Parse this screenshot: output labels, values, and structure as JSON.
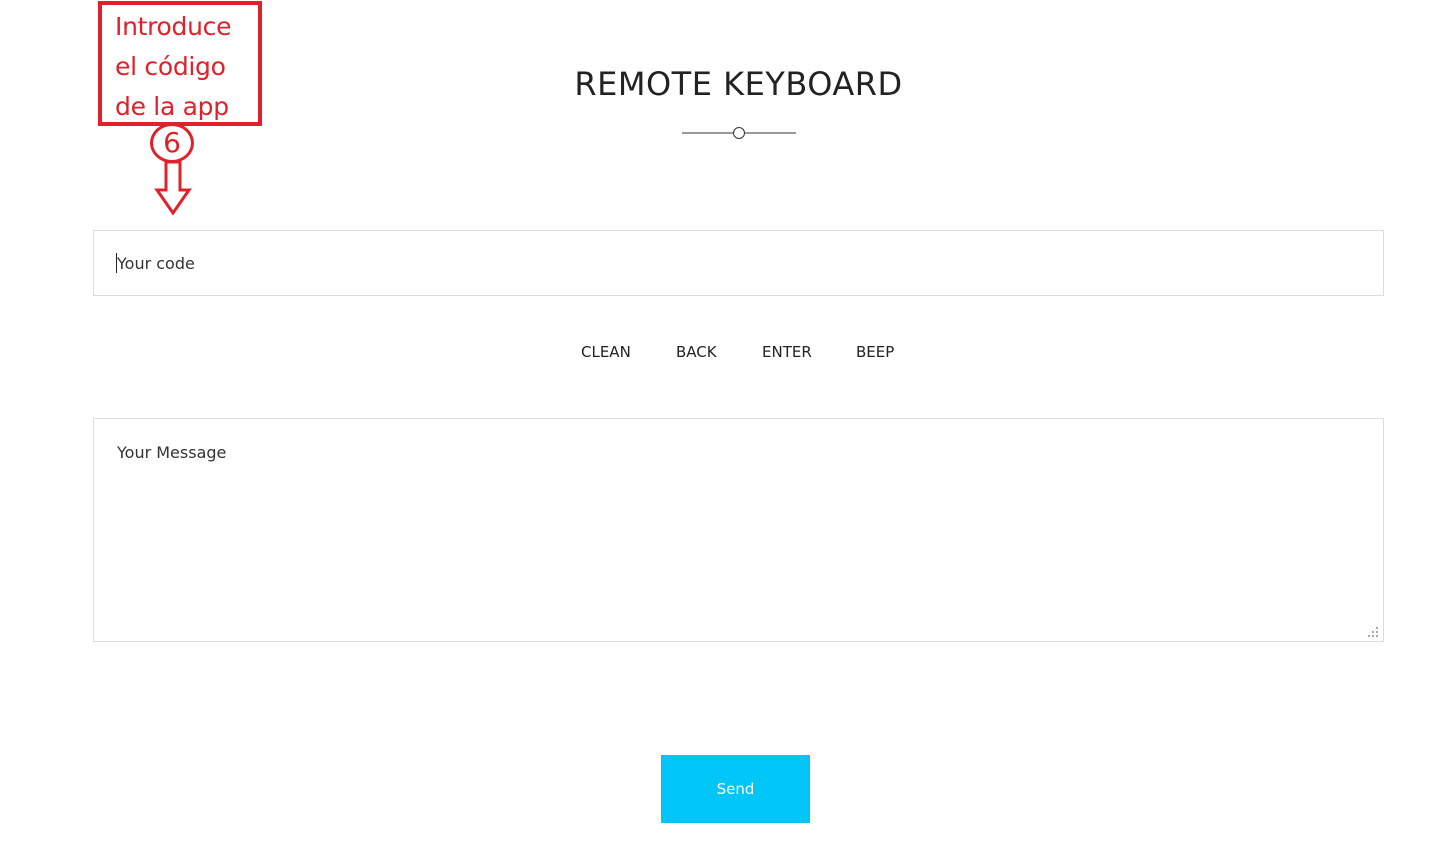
{
  "header": {
    "title": "REMOTE KEYBOARD"
  },
  "form": {
    "code_placeholder": "Your code",
    "message_placeholder": "Your Message",
    "send_label": "Send"
  },
  "keys": [
    {
      "label": "CLEAN"
    },
    {
      "label": "BACK"
    },
    {
      "label": "ENTER"
    },
    {
      "label": "BEEP"
    }
  ],
  "annotation": {
    "text": "Introduce\nel código\nde la app",
    "step": "6"
  },
  "colors": {
    "accent": "#00c6f8",
    "annotation": "#e0212b",
    "border": "#dddddd"
  }
}
